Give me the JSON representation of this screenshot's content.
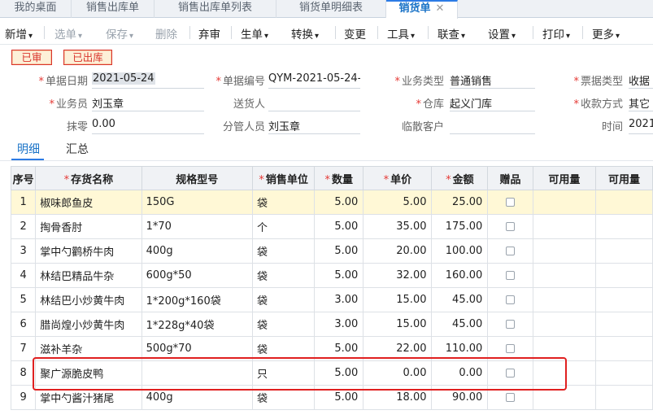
{
  "tabs": [
    {
      "label": "我的桌面"
    },
    {
      "label": "销售出库单"
    },
    {
      "label": "销售出库单列表"
    },
    {
      "label": "销货单明细表"
    },
    {
      "label": "销货单",
      "close": "✕"
    }
  ],
  "toolbar": {
    "items": [
      {
        "label": "新增",
        "caret": "▾"
      },
      {
        "label": "选单",
        "caret": "▾"
      },
      {
        "label": "保存",
        "caret": "▾"
      },
      {
        "label": "删除"
      },
      {
        "label": "弃审"
      },
      {
        "label": "生单",
        "caret": "▾"
      },
      {
        "label": "转换",
        "caret": "▾"
      },
      {
        "label": "变更"
      },
      {
        "label": "工具",
        "caret": "▾"
      },
      {
        "label": "联查",
        "caret": "▾"
      },
      {
        "label": "设置",
        "caret": "▾"
      },
      {
        "label": "打印",
        "caret": "▾"
      },
      {
        "label": "更多",
        "caret": "▾"
      }
    ]
  },
  "status": {
    "audited": "已审",
    "outbound": "已出库"
  },
  "form": {
    "date_label": "单据日期",
    "date_value": "2021-05-24",
    "code_label": "单据编号",
    "code_value": "QYM-2021-05-24-...",
    "biztype_label": "业务类型",
    "biztype_value": "普通销售",
    "invtype_label": "票据类型",
    "invtype_value": "收据",
    "sales_label": "业务员",
    "sales_value": "刘玉章",
    "delivery_label": "送货人",
    "delivery_value": "",
    "warehouse_label": "仓库",
    "warehouse_value": "起义门库",
    "paymode_label": "收款方式",
    "paymode_value": "其它",
    "round_label": "抹零",
    "round_value": "0.00",
    "manager_label": "分管人员",
    "manager_value": "刘玉章",
    "walkin_label": "临散客户",
    "walkin_value": "",
    "time_label": "时间",
    "time_value": "2021-"
  },
  "subtabs": {
    "detail": "明细",
    "summary": "汇总"
  },
  "grid": {
    "headers": {
      "idx": "序号",
      "name": "存货名称",
      "spec": "规格型号",
      "unit": "销售单位",
      "qty": "数量",
      "price": "单价",
      "amount": "金额",
      "gift": "赠品",
      "avail1": "可用量",
      "avail2": "可用量"
    },
    "rows": [
      {
        "idx": "1",
        "name": "椒味郎鱼皮",
        "spec": "150G",
        "unit": "袋",
        "qty": "5.00",
        "price": "5.00",
        "amount": "25.00"
      },
      {
        "idx": "2",
        "name": "掏骨香肘",
        "spec": "1*70",
        "unit": "个",
        "qty": "5.00",
        "price": "35.00",
        "amount": "175.00"
      },
      {
        "idx": "3",
        "name": "掌中勺鹳桥牛肉",
        "spec": "400g",
        "unit": "袋",
        "qty": "5.00",
        "price": "20.00",
        "amount": "100.00"
      },
      {
        "idx": "4",
        "name": "林结巴精品牛杂",
        "spec": "600g*50",
        "unit": "袋",
        "qty": "5.00",
        "price": "32.00",
        "amount": "160.00"
      },
      {
        "idx": "5",
        "name": "林结巴小炒黄牛肉",
        "spec": "1*200g*160袋",
        "unit": "袋",
        "qty": "3.00",
        "price": "15.00",
        "amount": "45.00"
      },
      {
        "idx": "6",
        "name": "腊尚煌小炒黄牛肉",
        "spec": "1*228g*40袋",
        "unit": "袋",
        "qty": "3.00",
        "price": "15.00",
        "amount": "45.00"
      },
      {
        "idx": "7",
        "name": "滋补羊杂",
        "spec": "500g*70",
        "unit": "袋",
        "qty": "5.00",
        "price": "22.00",
        "amount": "110.00"
      },
      {
        "idx": "8",
        "name": "聚广源脆皮鸭",
        "spec": "",
        "unit": "只",
        "qty": "5.00",
        "price": "0.00",
        "amount": "0.00"
      },
      {
        "idx": "9",
        "name": "掌中勺酱汁猪尾",
        "spec": "400g",
        "unit": "袋",
        "qty": "5.00",
        "price": "18.00",
        "amount": "90.00"
      }
    ]
  },
  "colors": {
    "accent": "#2c7be5",
    "stamp": "#d9342b",
    "highlight_box": "#e02020",
    "selected_row": "#fff8d6"
  }
}
